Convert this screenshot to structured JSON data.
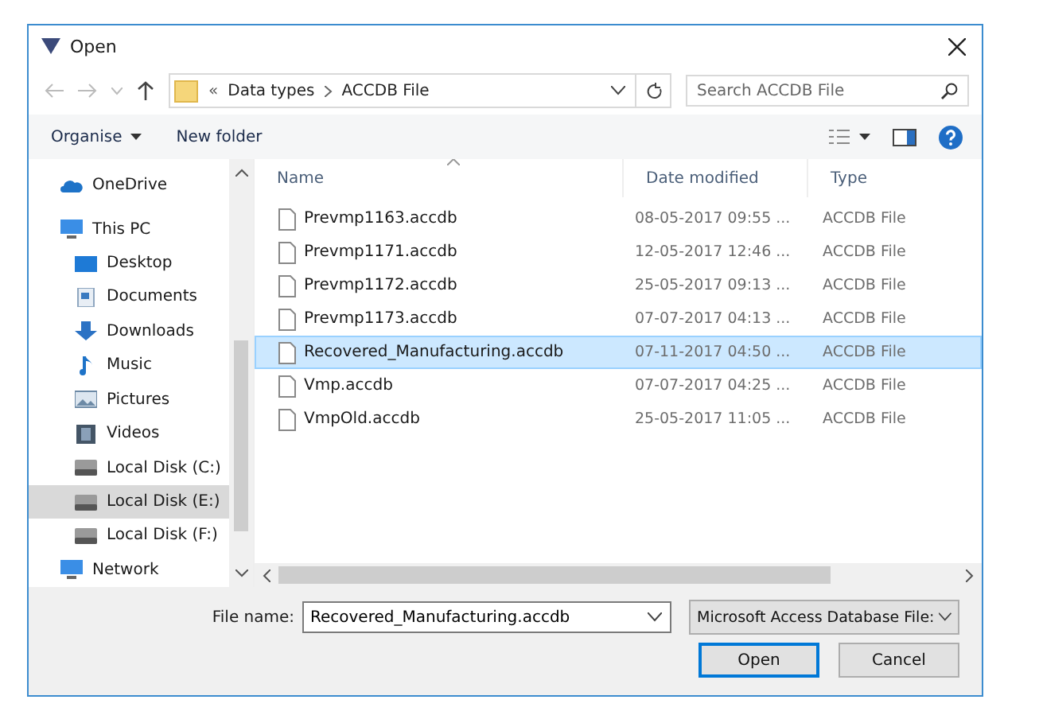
{
  "window": {
    "title": "Open"
  },
  "address": {
    "overflow": "«",
    "crumbs": [
      "Data types",
      "ACCDB File"
    ]
  },
  "search": {
    "placeholder": "Search ACCDB File"
  },
  "toolbar": {
    "organise": "Organise",
    "new_folder": "New folder"
  },
  "sidebar": {
    "items": [
      {
        "label": "OneDrive",
        "selected": false
      },
      {
        "label": "This PC",
        "selected": false,
        "children": [
          {
            "label": "Desktop",
            "selected": false
          },
          {
            "label": "Documents",
            "selected": false
          },
          {
            "label": "Downloads",
            "selected": false
          },
          {
            "label": "Music",
            "selected": false
          },
          {
            "label": "Pictures",
            "selected": false
          },
          {
            "label": "Videos",
            "selected": false
          },
          {
            "label": "Local Disk (C:)",
            "selected": false
          },
          {
            "label": "Local Disk (E:)",
            "selected": true
          },
          {
            "label": "Local Disk (F:)",
            "selected": false
          }
        ]
      },
      {
        "label": "Network",
        "selected": false
      }
    ]
  },
  "table": {
    "columns": [
      "Name",
      "Date modified",
      "Type"
    ],
    "rows": [
      {
        "name": "Prevmp1163.accdb",
        "date": "08-05-2017 09:55 ...",
        "type": "ACCDB File",
        "selected": false
      },
      {
        "name": "Prevmp1171.accdb",
        "date": "12-05-2017 12:46 ...",
        "type": "ACCDB File",
        "selected": false
      },
      {
        "name": "Prevmp1172.accdb",
        "date": "25-05-2017 09:13 ...",
        "type": "ACCDB File",
        "selected": false
      },
      {
        "name": "Prevmp1173.accdb",
        "date": "07-07-2017 04:13 ...",
        "type": "ACCDB File",
        "selected": false
      },
      {
        "name": "Recovered_Manufacturing.accdb",
        "date": "07-11-2017 04:50 ...",
        "type": "ACCDB File",
        "selected": true
      },
      {
        "name": "Vmp.accdb",
        "date": "07-07-2017 04:25 ...",
        "type": "ACCDB File",
        "selected": false
      },
      {
        "name": "VmpOld.accdb",
        "date": "25-05-2017 11:05 ...",
        "type": "ACCDB File",
        "selected": false
      }
    ]
  },
  "footer": {
    "file_name_label": "File name:",
    "file_name": "Recovered_Manufacturing.accdb",
    "file_type": "Microsoft Access Database File:",
    "open": "Open",
    "cancel": "Cancel"
  }
}
